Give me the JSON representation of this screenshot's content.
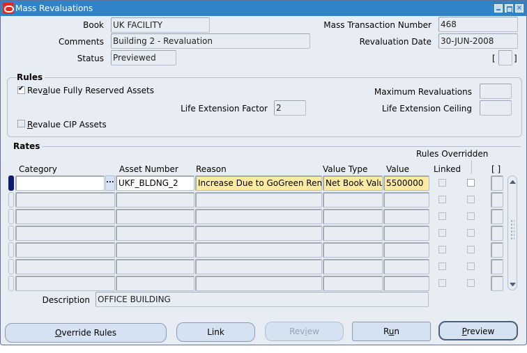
{
  "window": {
    "title": "Mass Revaluations",
    "controls": [
      "minimize",
      "maximize",
      "close"
    ]
  },
  "header": {
    "book_label": "Book",
    "book_value": "UK FACILITY",
    "comments_label": "Comments",
    "comments_value": "Building 2 - Revaluation",
    "status_label": "Status",
    "status_value": "Previewed",
    "mass_transaction_number_label": "Mass Transaction Number",
    "mass_transaction_number_value": "468",
    "revaluation_date_label": "Revaluation Date",
    "revaluation_date_value": "30-JUN-2008",
    "dff_open": "[",
    "dff_close": "]"
  },
  "rules": {
    "title": "Rules",
    "revalue_fully_reserved_label_pre": "Rev",
    "revalue_fully_reserved_label_u": "a",
    "revalue_fully_reserved_label_post": "lue Fully Reserved Assets",
    "revalue_fully_reserved_checked": true,
    "life_extension_factor_label": "Life Extension Factor",
    "life_extension_factor_value": "2",
    "revalue_cip_label_u": "R",
    "revalue_cip_label_post": "evalue CIP Assets",
    "revalue_cip_checked": false,
    "maximum_revaluations_label": "Maximum Revaluations",
    "maximum_revaluations_value": "",
    "life_extension_ceiling_label": "Life Extension Ceiling",
    "life_extension_ceiling_value": ""
  },
  "rates": {
    "title": "Rates",
    "rules_overridden_label": "Rules Overridden",
    "columns": {
      "category": "Category",
      "asset_number": "Asset Number",
      "reason": "Reason",
      "value_type": "Value Type",
      "value": "Value",
      "linked": "Linked",
      "dff": "[ ]"
    },
    "lov_button": "...",
    "rows": [
      {
        "category": "",
        "asset_number": "UKF_BLDNG_2",
        "reason": "Increase Due to GoGreen Renov",
        "value_type": "Net Book Value",
        "value": "5500000",
        "linked": false,
        "rules_overridden": false
      },
      {
        "category": "",
        "asset_number": "",
        "reason": "",
        "value_type": "",
        "value": "",
        "linked": false,
        "rules_overridden": false
      },
      {
        "category": "",
        "asset_number": "",
        "reason": "",
        "value_type": "",
        "value": "",
        "linked": false,
        "rules_overridden": false
      },
      {
        "category": "",
        "asset_number": "",
        "reason": "",
        "value_type": "",
        "value": "",
        "linked": false,
        "rules_overridden": false
      },
      {
        "category": "",
        "asset_number": "",
        "reason": "",
        "value_type": "",
        "value": "",
        "linked": false,
        "rules_overridden": false
      },
      {
        "category": "",
        "asset_number": "",
        "reason": "",
        "value_type": "",
        "value": "",
        "linked": false,
        "rules_overridden": false
      },
      {
        "category": "",
        "asset_number": "",
        "reason": "",
        "value_type": "",
        "value": "",
        "linked": false,
        "rules_overridden": false
      }
    ],
    "description_label": "Description",
    "description_value": "OFFICE BUILDING"
  },
  "buttons": {
    "override_rules_u": "O",
    "override_rules_post": "verride Rules",
    "link": "Link",
    "review_pre": "Rev",
    "review_u": "i",
    "review_post": "ew",
    "run_pre": "R",
    "run_u": "u",
    "run_post": "n",
    "preview_u": "P",
    "preview_post": "review"
  }
}
